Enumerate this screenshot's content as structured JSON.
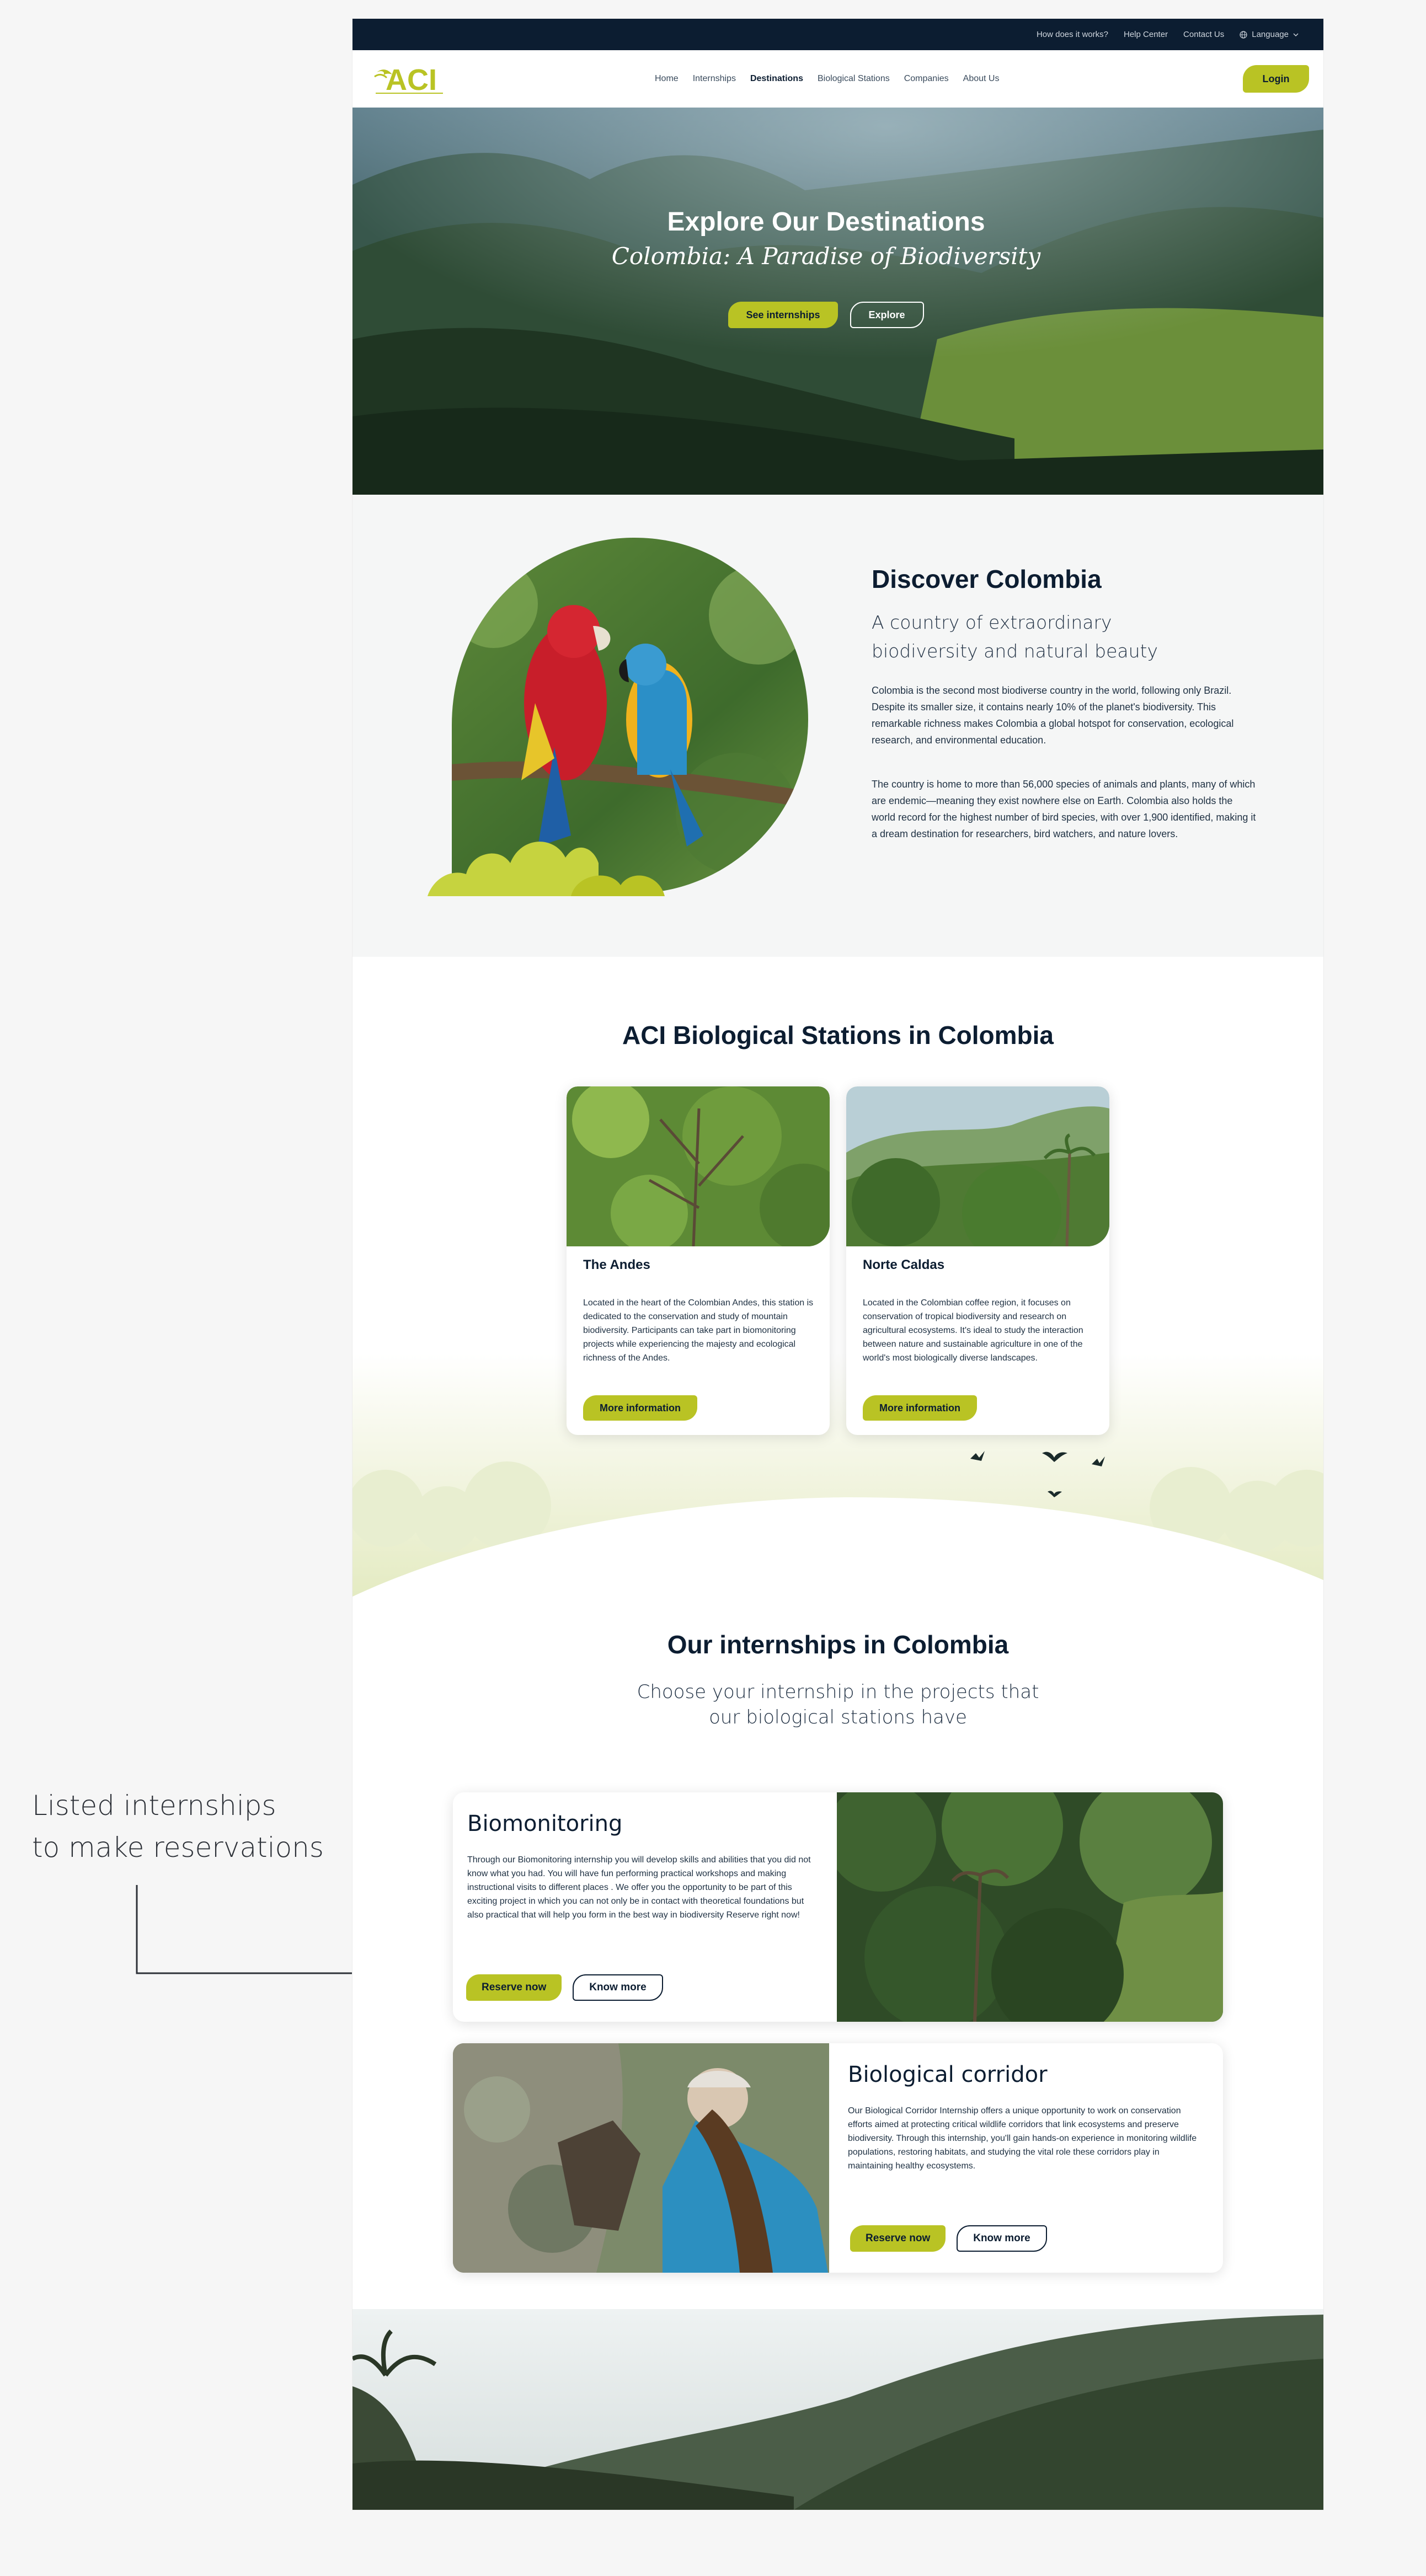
{
  "annotation": {
    "line1": "Listed internships",
    "line2": "to make reservations"
  },
  "topbar": {
    "links": [
      "How does it works?",
      "Help Center",
      "Contact Us"
    ],
    "language": "Language"
  },
  "logo": {
    "text": "ACI"
  },
  "nav": {
    "items": [
      "Home",
      "Internships",
      "Destinations",
      "Biological Stations",
      "Companies",
      "About Us"
    ],
    "active": "Destinations",
    "login": "Login"
  },
  "hero": {
    "title": "Explore Our Destinations",
    "subtitle": "Colombia: A Paradise of Biodiversity",
    "primary_button": "See internships",
    "secondary_button": "Explore"
  },
  "discover": {
    "title": "Discover Colombia",
    "subtitle": "A country of extraordinary biodiversity and natural beauty",
    "paragraph1": "Colombia is the second most biodiverse country in the world, following only Brazil. Despite its smaller size, it contains nearly 10% of the planet's biodiversity. This remarkable richness makes Colombia a global hotspot for conservation, ecological research, and environmental education.",
    "paragraph2": "The country is home to more than 56,000 species of animals and plants, many of which are endemic—meaning they exist nowhere else on Earth. Colombia also holds the world record for the highest number of bird species, with over 1,900 identified, making it a dream destination for researchers, bird watchers, and nature lovers."
  },
  "stations": {
    "title": "ACI Biological Stations in Colombia",
    "cards": [
      {
        "name": "The Andes",
        "description": "Located in the heart of the Colombian Andes, this station is dedicated to the conservation and study of mountain biodiversity. Participants can take part in biomonitoring projects while experiencing the majesty and ecological richness of the Andes.",
        "button": "More information"
      },
      {
        "name": "Norte Caldas",
        "description": "Located in the Colombian coffee region, it focuses on conservation of tropical biodiversity and research on agricultural ecosystems. It's ideal to study the interaction between nature and sustainable agriculture in one of the world's most biologically diverse landscapes.",
        "button": "More information"
      }
    ]
  },
  "internships": {
    "title": "Our internships in Colombia",
    "subtitle_line1": "Choose your internship in the projects that",
    "subtitle_line2": "our biological stations have",
    "items": [
      {
        "title": "Biomonitoring",
        "description": "Through our Biomonitoring internship you will develop skills and abilities that you did not know what you had. You will have fun performing practical workshops and making instructional visits to different places . We offer you the opportunity to be part of this exciting project in which you can not only be in contact with theoretical foundations but also practical that will help you form in the best way in biodiversity Reserve right now!",
        "reserve": "Reserve now",
        "know": "Know more"
      },
      {
        "title": "Biological corridor",
        "description": "Our Biological Corridor Internship offers a unique opportunity to work on conservation efforts aimed at protecting critical wildlife corridors that link ecosystems and preserve biodiversity. Through this internship, you'll gain hands-on experience in monitoring wildlife populations, restoring habitats, and studying the vital role these corridors play in maintaining healthy ecosystems.",
        "reserve": "Reserve now",
        "know": "Know more"
      }
    ]
  },
  "colors": {
    "navy": "#0c1d31",
    "accent_green": "#b9c324",
    "page_bg": "#f6f6f6"
  }
}
